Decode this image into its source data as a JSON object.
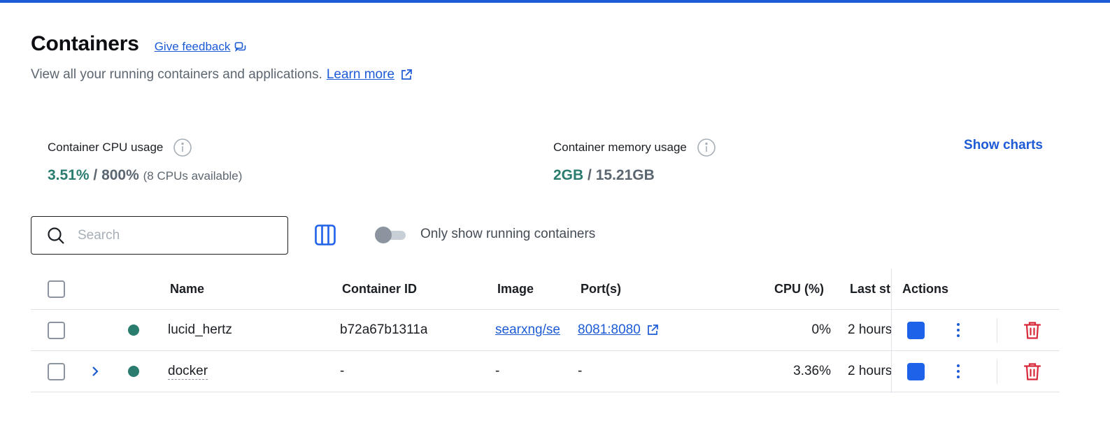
{
  "header": {
    "title": "Containers",
    "feedback_label": "Give feedback",
    "subtitle": "View all your running containers and applications.",
    "learn_more_label": "Learn more"
  },
  "stats": {
    "cpu": {
      "label": "Container CPU usage",
      "used": "3.51%",
      "separator": "/",
      "total": "800%",
      "note": "(8 CPUs available)"
    },
    "memory": {
      "label": "Container memory usage",
      "used": "2GB",
      "separator": "/",
      "total": "15.21GB"
    },
    "show_charts_label": "Show charts"
  },
  "toolbar": {
    "search_placeholder": "Search",
    "search_value": "",
    "only_running_label": "Only show running containers",
    "only_running_enabled": false
  },
  "table": {
    "columns": {
      "name": "Name",
      "container_id": "Container ID",
      "image": "Image",
      "ports": "Port(s)",
      "cpu": "CPU (%)",
      "last_started": "Last st",
      "actions": "Actions"
    },
    "rows": [
      {
        "name": "lucid_hertz",
        "container_id": "b72a67b1311a",
        "image": "searxng/se",
        "ports": "8081:8080",
        "cpu": "0%",
        "last_started": "2 hours"
      },
      {
        "name": "docker",
        "container_id": "-",
        "image": "-",
        "ports": "-",
        "cpu": "3.36%",
        "last_started": "2 hours"
      }
    ]
  },
  "colors": {
    "accent": "#1d5bd6",
    "running_status": "#2a7c6f",
    "delete": "#d8293a"
  },
  "icons": {
    "feedback": "feedback-chat-icon",
    "external": "external-link-icon",
    "info": "info-icon",
    "search": "search-icon",
    "columns": "columns-icon",
    "expand": "chevron-right-icon",
    "stop": "stop-icon",
    "more": "kebab-menu-icon",
    "delete": "trash-icon"
  }
}
